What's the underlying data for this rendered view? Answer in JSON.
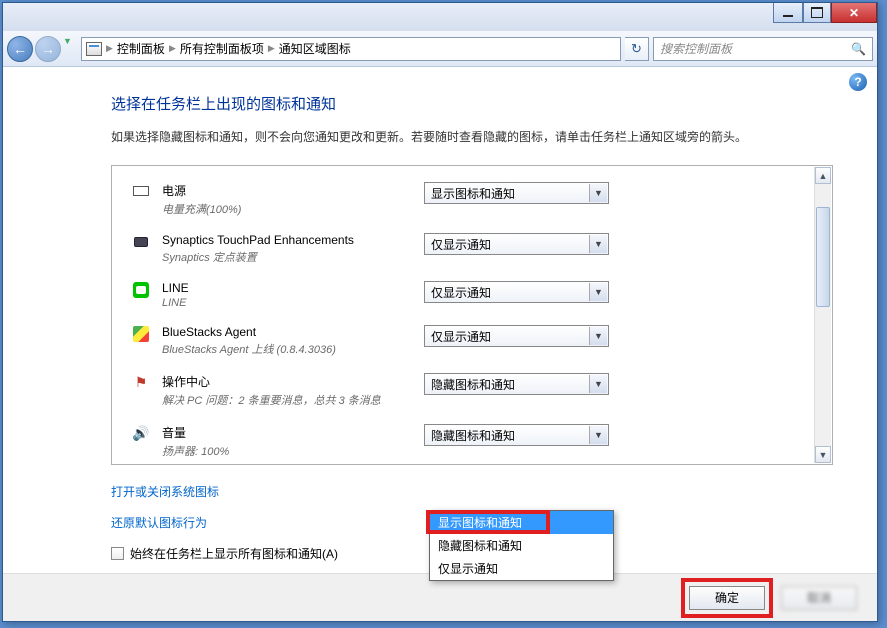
{
  "window": {
    "breadcrumb": [
      "控制面板",
      "所有控制面板项",
      "通知区域图标"
    ],
    "search_placeholder": "搜索控制面板"
  },
  "page": {
    "title": "选择在任务栏上出现的图标和通知",
    "description": "如果选择隐藏图标和通知，则不会向您通知更改和更新。若要随时查看隐藏的图标，请单击任务栏上通知区域旁的箭头。"
  },
  "items": [
    {
      "name": "电源",
      "sub": "电量充满(100%)",
      "value": "显示图标和通知"
    },
    {
      "name": "Synaptics TouchPad Enhancements",
      "sub": "Synaptics 定点装置",
      "value": "仅显示通知"
    },
    {
      "name": "LINE",
      "sub": "LINE",
      "value": "仅显示通知"
    },
    {
      "name": "BlueStacks Agent",
      "sub": "BlueStacks Agent 上线 (0.8.4.3036)",
      "value": "仅显示通知"
    },
    {
      "name": "操作中心",
      "sub": "解决 PC 问题：2 条重要消息，总共 3 条消息",
      "value": "隐藏图标和通知"
    },
    {
      "name": "音量",
      "sub": "扬声器: 100%",
      "value": "隐藏图标和通知"
    }
  ],
  "dropdown": {
    "options": [
      "显示图标和通知",
      "隐藏图标和通知",
      "仅显示通知"
    ],
    "selected": "显示图标和通知",
    "current_combo": "隐藏图标和通知"
  },
  "links": {
    "system_icons": "打开或关闭系统图标",
    "restore": "还原默认图标行为"
  },
  "checkbox": {
    "label": "始终在任务栏上显示所有图标和通知(A)"
  },
  "buttons": {
    "ok": "确定",
    "cancel": "取消"
  }
}
